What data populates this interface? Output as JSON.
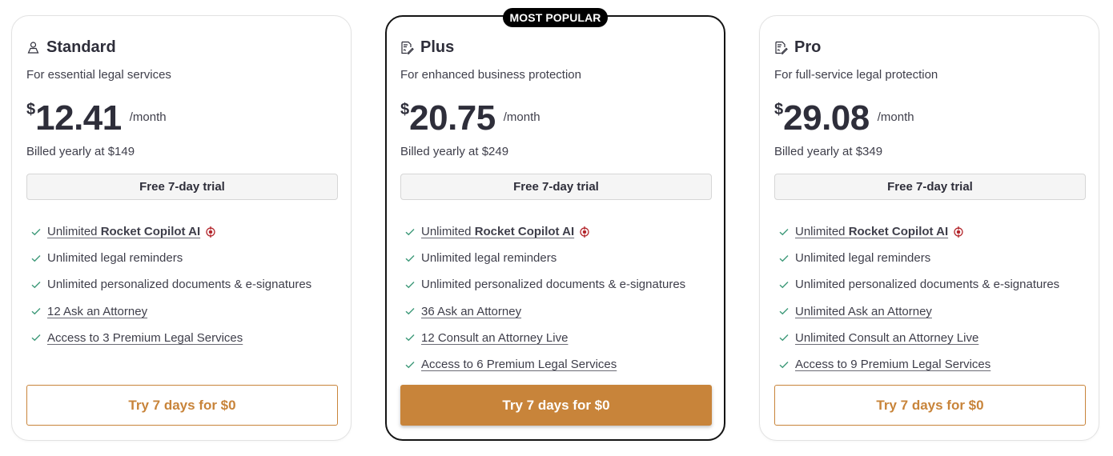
{
  "accent_color": "#c8843a",
  "plans": [
    {
      "name": "Standard",
      "icon": "person-icon",
      "subtitle": "For essential legal services",
      "currency": "$",
      "amount": "12.41",
      "period": "/month",
      "billed": "Billed yearly at $149",
      "trial": "Free 7-day trial",
      "features": [
        {
          "prefix": "Unlimited ",
          "bold": "Rocket Copilot AI",
          "text": "",
          "underline": true,
          "ai": true
        },
        {
          "prefix": "",
          "bold": "",
          "text": "Unlimited legal reminders",
          "underline": false,
          "ai": false
        },
        {
          "prefix": "",
          "bold": "",
          "text": "Unlimited personalized documents & e-signatures",
          "underline": false,
          "ai": false
        },
        {
          "prefix": "",
          "bold": "",
          "text": "12 Ask an Attorney",
          "underline": true,
          "ai": false
        },
        {
          "prefix": "",
          "bold": "",
          "text": "Access to 3 Premium Legal Services",
          "underline": true,
          "ai": false
        }
      ],
      "cta": "Try 7 days for $0"
    },
    {
      "name": "Plus",
      "icon": "document-signature-icon",
      "badge": "MOST POPULAR",
      "subtitle": "For enhanced business protection",
      "currency": "$",
      "amount": "20.75",
      "period": "/month",
      "billed": "Billed yearly at $249",
      "trial": "Free 7-day trial",
      "features": [
        {
          "prefix": "Unlimited ",
          "bold": "Rocket Copilot AI",
          "text": "",
          "underline": true,
          "ai": true
        },
        {
          "prefix": "",
          "bold": "",
          "text": "Unlimited legal reminders",
          "underline": false,
          "ai": false
        },
        {
          "prefix": "",
          "bold": "",
          "text": "Unlimited personalized documents & e-signatures",
          "underline": false,
          "ai": false
        },
        {
          "prefix": "",
          "bold": "",
          "text": "36 Ask an Attorney",
          "underline": true,
          "ai": false
        },
        {
          "prefix": "",
          "bold": "",
          "text": "12 Consult an Attorney Live",
          "underline": true,
          "ai": false
        },
        {
          "prefix": "",
          "bold": "",
          "text": "Access to 6 Premium Legal Services",
          "underline": true,
          "ai": false
        }
      ],
      "cta": "Try 7 days for $0"
    },
    {
      "name": "Pro",
      "icon": "document-signature-icon",
      "subtitle": "For full-service legal protection",
      "currency": "$",
      "amount": "29.08",
      "period": "/month",
      "billed": "Billed yearly at $349",
      "trial": "Free 7-day trial",
      "features": [
        {
          "prefix": "Unlimited ",
          "bold": "Rocket Copilot AI",
          "text": "",
          "underline": true,
          "ai": true
        },
        {
          "prefix": "",
          "bold": "",
          "text": "Unlimited legal reminders",
          "underline": false,
          "ai": false
        },
        {
          "prefix": "",
          "bold": "",
          "text": "Unlimited personalized documents & e-signatures",
          "underline": false,
          "ai": false
        },
        {
          "prefix": "",
          "bold": "",
          "text": "Unlimited Ask an Attorney",
          "underline": true,
          "ai": false
        },
        {
          "prefix": "",
          "bold": "",
          "text": "Unlimited Consult an Attorney Live",
          "underline": true,
          "ai": false
        },
        {
          "prefix": "",
          "bold": "",
          "text": "Access to 9 Premium Legal Services",
          "underline": true,
          "ai": false
        }
      ],
      "cta": "Try 7 days for $0"
    }
  ]
}
